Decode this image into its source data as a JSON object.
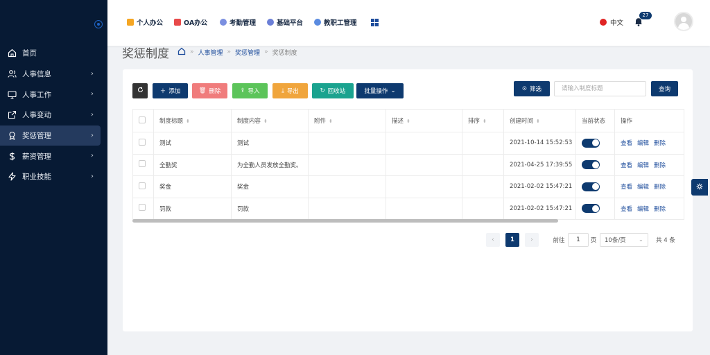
{
  "sidebar": {
    "items": [
      {
        "label": "首页",
        "icon": "home-icon",
        "has_arrow": false
      },
      {
        "label": "人事信息",
        "icon": "users-icon",
        "has_arrow": true
      },
      {
        "label": "人事工作",
        "icon": "monitor-icon",
        "has_arrow": true
      },
      {
        "label": "人事变动",
        "icon": "external-link-icon",
        "has_arrow": true
      },
      {
        "label": "奖惩管理",
        "icon": "award-icon",
        "has_arrow": true,
        "active": true
      },
      {
        "label": "薪资管理",
        "icon": "dollar-icon",
        "has_arrow": true
      },
      {
        "label": "职业技能",
        "icon": "bolt-icon",
        "has_arrow": true
      }
    ]
  },
  "topnav": {
    "links": [
      "个人办公",
      "OA办公",
      "考勤管理",
      "基础平台",
      "教职工管理"
    ],
    "language": "中文",
    "notification_count": "27"
  },
  "breadcrumb": {
    "title": "奖惩制度",
    "items": [
      "人事管理",
      "奖惩管理",
      "奖惩制度"
    ]
  },
  "toolbar": {
    "refresh_label": "",
    "add_label": "添加",
    "delete_label": "删除",
    "import_label": "导入",
    "export_label": "导出",
    "recycle_label": "回收站",
    "batch_label": "批量操作",
    "filter_label": "筛选",
    "search_placeholder": "请输入制度标题",
    "query_label": "查询"
  },
  "colors": {
    "primary": "#0e3a6f",
    "danger": "#f07c7c",
    "success": "#5cc45a",
    "warning": "#f0a53c",
    "teal": "#1aa38f"
  },
  "table": {
    "headers": [
      "制度标题",
      "制度内容",
      "附件",
      "描述",
      "排序",
      "创建时间",
      "当前状态",
      "操作"
    ],
    "rows": [
      {
        "title": "测试",
        "content": "测试",
        "attachment": "",
        "description": "",
        "order": "",
        "created": "2021-10-14 15:52:53",
        "status_on": true
      },
      {
        "title": "全勤奖",
        "content": "为全勤人员发放全勤奖。",
        "attachment": "",
        "description": "",
        "order": "",
        "created": "2021-04-25 17:39:55",
        "status_on": true
      },
      {
        "title": "奖金",
        "content": "奖金",
        "attachment": "",
        "description": "",
        "order": "",
        "created": "2021-02-02 15:47:21",
        "status_on": true
      },
      {
        "title": "罚款",
        "content": "罚款",
        "attachment": "",
        "description": "",
        "order": "",
        "created": "2021-02-02 15:47:21",
        "status_on": true
      }
    ],
    "actions": [
      "查看",
      "编辑",
      "删除"
    ]
  },
  "pagination": {
    "current": "1",
    "goto_label": "前往",
    "goto_value": "1",
    "page_suffix": "页",
    "page_size": "10条/页",
    "total": "共 4 条"
  }
}
